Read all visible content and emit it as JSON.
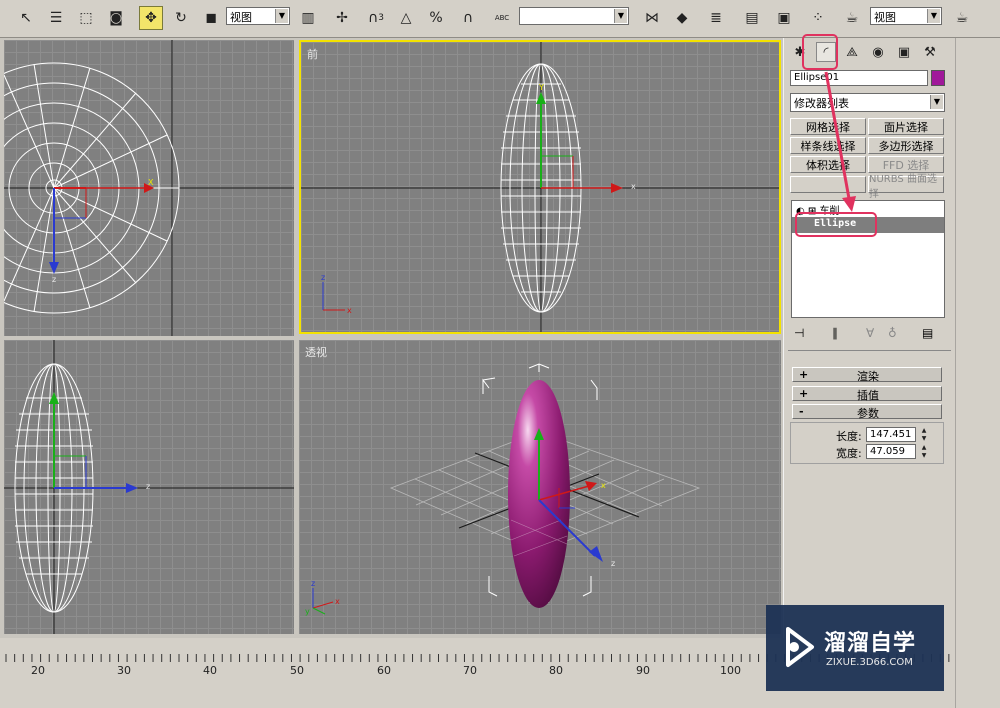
{
  "toolbar": {
    "view_combo": "视图",
    "view_combo2": "视图",
    "named_selection": "",
    "abc_label": "ABC",
    "snap_label": "3"
  },
  "viewports": {
    "front_label": "前",
    "perspective_label": "透视"
  },
  "command_panel": {
    "object_name": "Ellipse01",
    "object_color": "#a0189a",
    "modifier_list": "修改器列表",
    "buttons": [
      "网格选择",
      "面片选择",
      "样条线选择",
      "多边形选择",
      "体积选择",
      "FFD 选择",
      "",
      "NURBS 曲面选择"
    ],
    "stack": {
      "group_label": "车削",
      "selected_item": "Ellipse"
    },
    "rollouts": [
      {
        "sign": "+",
        "title": "渲染"
      },
      {
        "sign": "+",
        "title": "插值"
      },
      {
        "sign": "-",
        "title": "参数"
      }
    ],
    "params": {
      "length_label": "长度:",
      "length_value": "147.451",
      "width_label": "宽度:",
      "width_value": "47.059"
    }
  },
  "timeline": {
    "ticks": [
      "20",
      "30",
      "40",
      "50",
      "60",
      "70",
      "80",
      "90",
      "100"
    ]
  },
  "watermark": {
    "brand": "溜溜自学",
    "url": "ZIXUE.3D66.COM"
  },
  "colors": {
    "highlight": "#e0325f",
    "active_viewport_border": "#f3e200",
    "ellipse_wire": "#ffffff",
    "ellipse_shaded": "#8a1a6e"
  }
}
